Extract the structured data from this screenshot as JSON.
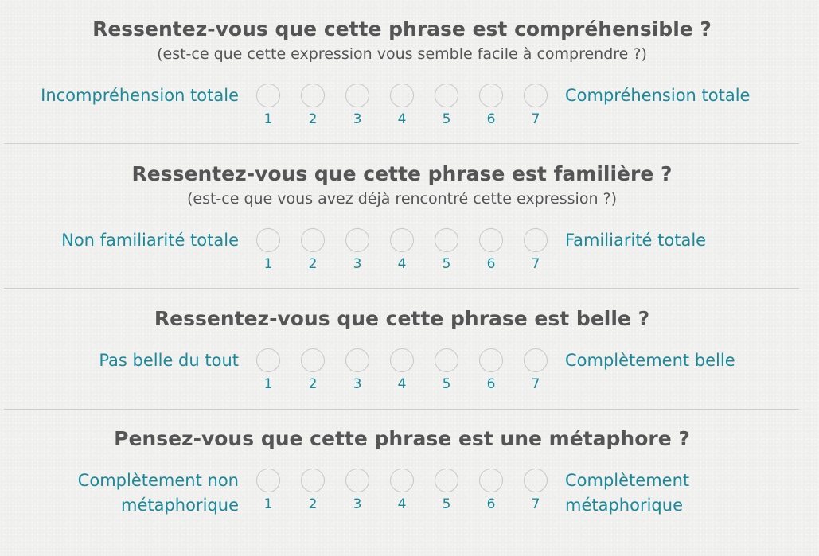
{
  "scale_options": [
    "1",
    "2",
    "3",
    "4",
    "5",
    "6",
    "7"
  ],
  "questions": [
    {
      "title": "Ressentez-vous que cette phrase est compréhensible ?",
      "subtitle": "(est-ce que cette expression vous semble facile à comprendre ?)",
      "left_label": "Incompréhension totale",
      "right_label": "Compréhension totale"
    },
    {
      "title": "Ressentez-vous que cette phrase est familière ?",
      "subtitle": "(est-ce que vous avez déjà rencontré cette expression ?)",
      "left_label": "Non familiarité totale",
      "right_label": "Familiarité totale"
    },
    {
      "title": "Ressentez-vous que cette phrase est belle ?",
      "left_label": "Pas belle du tout",
      "right_label": "Complètement belle"
    },
    {
      "title": "Pensez-vous que cette phrase est une métaphore ?",
      "left_label_lines": [
        "Complètement non",
        "métaphorique"
      ],
      "right_label_lines": [
        "Complètement",
        "métaphorique"
      ]
    }
  ],
  "colors": {
    "title": "#555555",
    "scale_label": "#1a8a9a",
    "radio_border": "#c8c8c8",
    "divider": "#cfcfcf"
  }
}
